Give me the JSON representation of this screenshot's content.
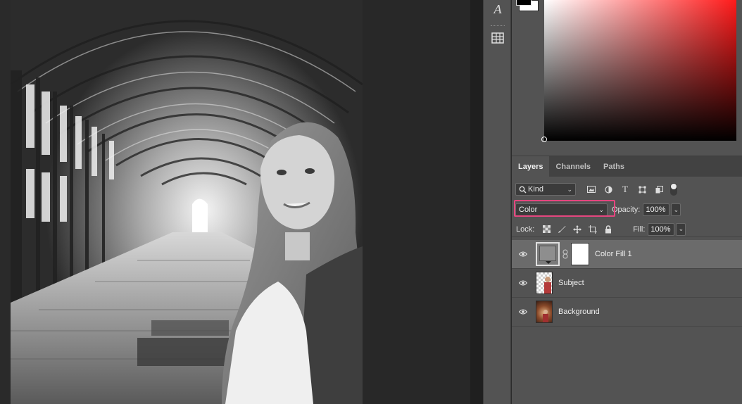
{
  "tools": {
    "type_tool_glyph": "A",
    "tool_icon": "table-tool-icon"
  },
  "color": {
    "foreground": "#000000",
    "background": "#ffffff",
    "hue": "#ff1a1a"
  },
  "layers_panel": {
    "tabs": [
      {
        "label": "Layers",
        "active": true
      },
      {
        "label": "Channels",
        "active": false
      },
      {
        "label": "Paths",
        "active": false
      }
    ],
    "filter": {
      "kind_label": "Kind",
      "icons": [
        "image-icon",
        "adjustment-icon",
        "type-icon",
        "shape-icon",
        "smart-object-icon"
      ]
    },
    "blend_mode": "Color",
    "opacity_label": "Opacity:",
    "opacity_value": "100%",
    "lock_label": "Lock:",
    "fill_label": "Fill:",
    "fill_value": "100%",
    "highlight_color": "#e5467f",
    "layers": [
      {
        "name": "Color Fill 1",
        "visible": true,
        "selected": true
      },
      {
        "name": "Subject",
        "visible": true,
        "selected": false
      },
      {
        "name": "Background",
        "visible": true,
        "selected": false
      }
    ]
  }
}
